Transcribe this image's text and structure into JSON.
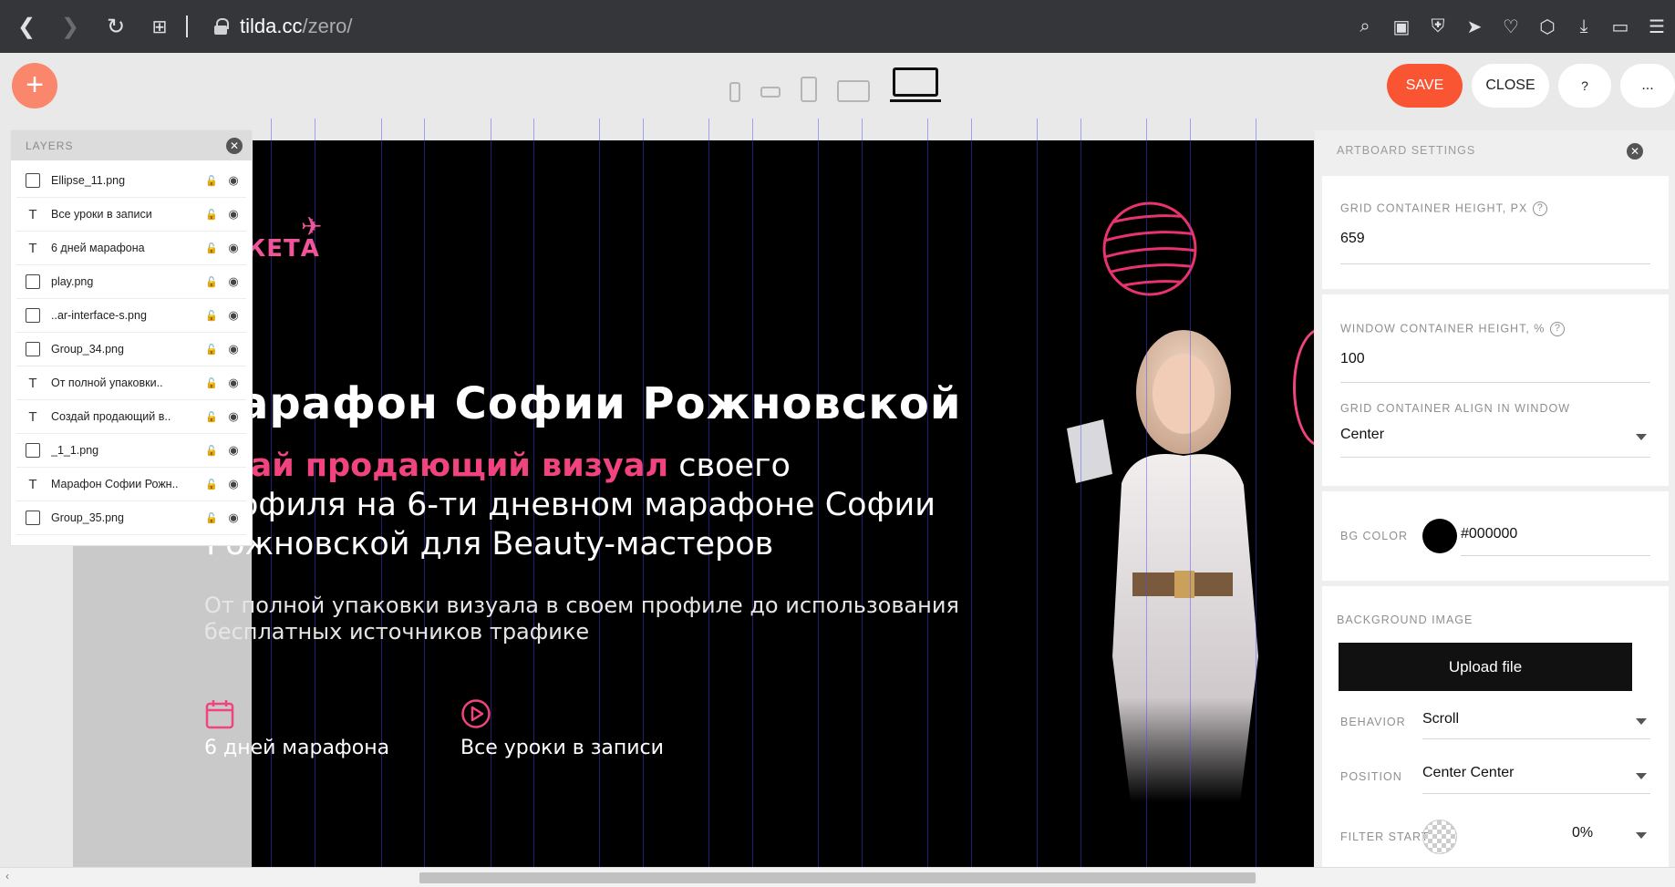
{
  "browser": {
    "host": "tilda.cc",
    "path": "/zero/"
  },
  "toolbar": {
    "save_label": "SAVE",
    "close_label": "CLOSE",
    "help_label": "?",
    "more_label": "..."
  },
  "layers": {
    "title": "LAYERS",
    "items": [
      {
        "name": "Ellipse_11.png",
        "type": "image"
      },
      {
        "name": "Все уроки в записи",
        "type": "text"
      },
      {
        "name": "6 дней марафона",
        "type": "text"
      },
      {
        "name": "play.png",
        "type": "image"
      },
      {
        "name": "..ar-interface-s.png",
        "type": "image"
      },
      {
        "name": "Group_34.png",
        "type": "image"
      },
      {
        "name": "От полной упаковки..",
        "type": "text"
      },
      {
        "name": "Создай продающий в..",
        "type": "text"
      },
      {
        "name": "_1_1.png",
        "type": "image"
      },
      {
        "name": "Марафон Софии Рожн..",
        "type": "text"
      },
      {
        "name": "Group_35.png",
        "type": "image"
      }
    ]
  },
  "canvas": {
    "logo": "КЕТА",
    "headline": "арафон Софии Рожновской",
    "sub_highlight": "здай продающий визуал",
    "sub_rest_1": " своего",
    "sub_line_2": "офиля на 6-ти дневном марафоне Софии",
    "sub_line_3": "Рожновской для Beauty-мастеров",
    "desc_line_1": "От полной упаковки визуала в своем профиле до использования",
    "desc_line_2": "бесплатных источников трафике",
    "feature_1": "6 дней марафона",
    "feature_2": "Все уроки в записи"
  },
  "settings": {
    "title": "ARTBOARD SETTINGS",
    "grid_height_label": "GRID CONTAINER HEIGHT, PX",
    "grid_height_value": "659",
    "window_height_label": "WINDOW CONTAINER HEIGHT, %",
    "window_height_value": "100",
    "align_label": "GRID CONTAINER ALIGN IN WINDOW",
    "align_value": "Center",
    "bg_color_label": "BG COLOR",
    "bg_color_value": "#000000",
    "bg_image_label": "BACKGROUND IMAGE",
    "upload_label": "Upload file",
    "behavior_label": "BEHAVIOR",
    "behavior_value": "Scroll",
    "position_label": "POSITION",
    "position_value": "Center Center",
    "filter_start_label": "FILTER START",
    "filter_start_value": "0%"
  },
  "colors": {
    "accent": "#fa5533",
    "add_button": "#fa876b",
    "highlight_pink": "#f0437f",
    "canvas_bg": "#000000"
  }
}
